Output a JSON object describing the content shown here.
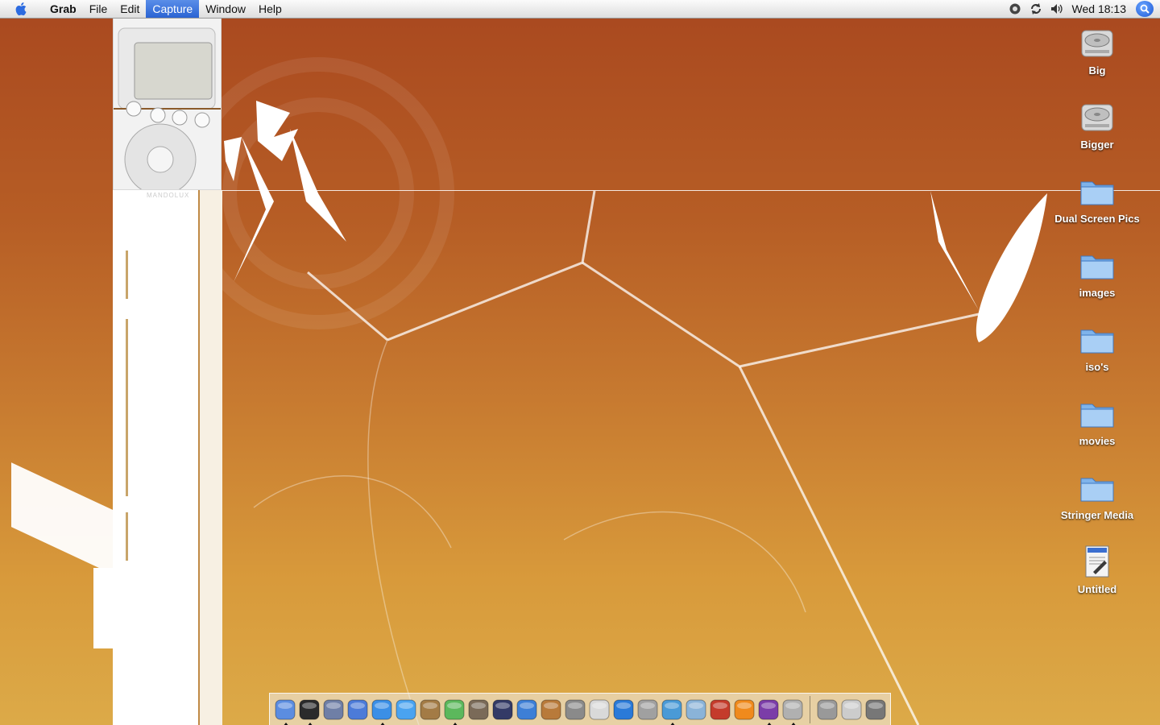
{
  "menubar": {
    "app_name": "Grab",
    "menus": [
      "File",
      "Edit",
      "Capture",
      "Window",
      "Help"
    ],
    "active_menu": "Capture",
    "clock": "Wed 18:13"
  },
  "desktop_icons": [
    {
      "label": "Big",
      "kind": "disk-icon"
    },
    {
      "label": "Bigger",
      "kind": "disk-icon"
    },
    {
      "label": "Dual Screen Pics",
      "kind": "folder-icon"
    },
    {
      "label": "images",
      "kind": "folder-icon"
    },
    {
      "label": "iso's",
      "kind": "folder-icon"
    },
    {
      "label": "movies",
      "kind": "folder-icon"
    },
    {
      "label": "Stringer Media",
      "kind": "folder-icon"
    },
    {
      "label": "Untitled",
      "kind": "document-icon"
    }
  ],
  "wallpaper": {
    "brand_text": "MANDOLUX"
  },
  "dock": {
    "apps": [
      {
        "icon": "finder-icon",
        "color": "#5b8de0",
        "running": true
      },
      {
        "icon": "dashboard-icon",
        "color": "#2b2b2b",
        "running": true
      },
      {
        "icon": "preview-icon",
        "color": "#6f7fa6",
        "running": false
      },
      {
        "icon": "fetch-icon",
        "color": "#4c7bd8",
        "running": false
      },
      {
        "icon": "safari-icon",
        "color": "#3b8fe6",
        "running": true
      },
      {
        "icon": "ichat-icon",
        "color": "#4aa3f0",
        "running": false
      },
      {
        "icon": "address-book-icon",
        "color": "#a37b45",
        "running": false
      },
      {
        "icon": "itunes-icon",
        "color": "#5cb85c",
        "running": true
      },
      {
        "icon": "iphoto-icon",
        "color": "#7a6a58",
        "running": false
      },
      {
        "icon": "imovie-icon",
        "color": "#333a66",
        "running": false
      },
      {
        "icon": "idvd-icon",
        "color": "#3d7fd6",
        "running": false
      },
      {
        "icon": "garageband-icon",
        "color": "#b87a3a",
        "running": false
      },
      {
        "icon": "iweb-icon",
        "color": "#8a8a8a",
        "running": false
      },
      {
        "icon": "ical-icon",
        "color": "#d9d9d9",
        "running": false
      },
      {
        "icon": "quicktime-icon",
        "color": "#2a7ad8",
        "running": false
      },
      {
        "icon": "system-preferences-icon",
        "color": "#a0a0a0",
        "running": false
      },
      {
        "icon": "messenger-icon",
        "color": "#4a9ad6",
        "running": true
      },
      {
        "icon": "handheld-icon",
        "color": "#8ab3d8",
        "running": false
      },
      {
        "icon": "filezilla-icon",
        "color": "#c43b2b",
        "running": false
      },
      {
        "icon": "vlc-icon",
        "color": "#f08a1c",
        "running": false
      },
      {
        "icon": "yahoo-messenger-icon",
        "color": "#7b3da8",
        "running": true
      },
      {
        "icon": "utility-icon",
        "color": "#b0b0b0",
        "running": true
      }
    ],
    "right_items": [
      {
        "icon": "mail-icon",
        "color": "#999999"
      },
      {
        "icon": "downloads-stack-icon",
        "color": "#cccccc"
      },
      {
        "icon": "trash-icon",
        "color": "#777777"
      }
    ]
  }
}
